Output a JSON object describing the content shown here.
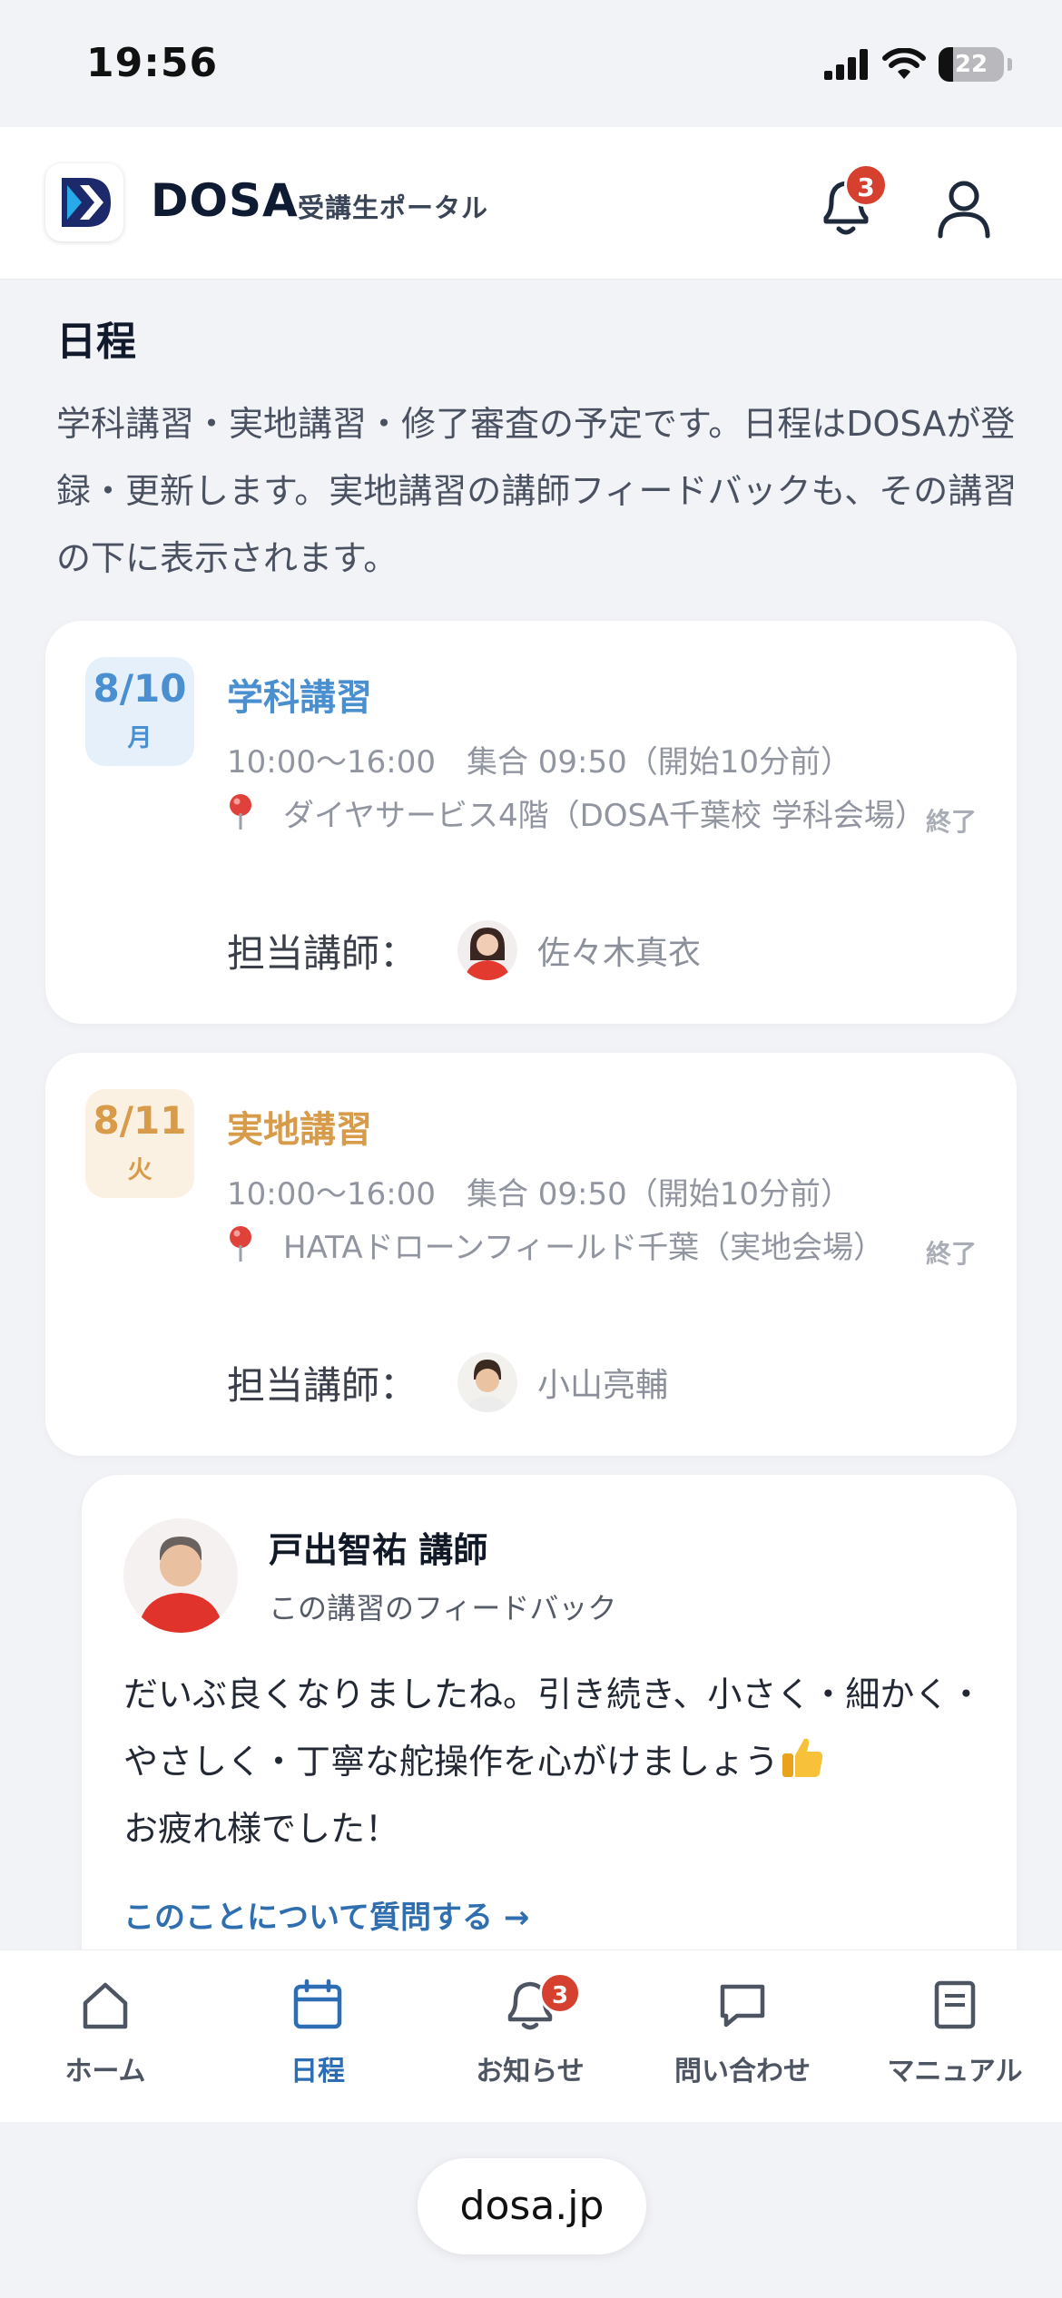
{
  "status_bar": {
    "time": "19:56",
    "battery": "22"
  },
  "header": {
    "brand": "DOSA",
    "subtitle": "受講生ポータル",
    "notification_count": "3"
  },
  "section": {
    "title": "日程",
    "intro": "学科講習・実地講習・修了審査の予定です。日程はDOSAが登録・更新します。実地講習の講師フィードバックも、その講習の下に表示されます。"
  },
  "events": [
    {
      "date": "8/10",
      "dow": "月",
      "title": "学科講習",
      "time": "10:00〜16:00　集合 09:50（開始10分前）",
      "place": "ダイヤサービス4階（DOSA千葉校 学科会場）",
      "status": "終了",
      "instructor_label": "担当講師：",
      "instructor_name": "佐々木真衣",
      "accent": "#4a8fd0",
      "date_bg": "#e6f0fb"
    },
    {
      "date": "8/11",
      "dow": "火",
      "title": "実地講習",
      "time": "10:00〜16:00　集合 09:50（開始10分前）",
      "place": "HATAドローンフィールド千葉（実地会場）",
      "status": "終了",
      "instructor_label": "担当講師：",
      "instructor_name": "小山亮輔",
      "accent": "#d89b4a",
      "date_bg": "#fbf1e3"
    }
  ],
  "feedback": {
    "name": "戸出智祐 講師",
    "subtitle": "この講習のフィードバック",
    "message": "だいぶ良くなりましたね。引き続き、小さく・細かく・やさしく・丁寧な舵操作を心がけましょう",
    "message_end": "お疲れ様でした！",
    "link": "このことについて質問する →"
  },
  "nav": {
    "items": [
      {
        "label": "ホーム",
        "icon": "home-icon"
      },
      {
        "label": "日程",
        "icon": "calendar-icon"
      },
      {
        "label": "お知らせ",
        "icon": "bell-icon",
        "badge": "3"
      },
      {
        "label": "問い合わせ",
        "icon": "chat-icon"
      },
      {
        "label": "マニュアル",
        "icon": "manual-icon"
      }
    ],
    "active": "日程"
  },
  "browser": {
    "url": "dosa.jp"
  }
}
